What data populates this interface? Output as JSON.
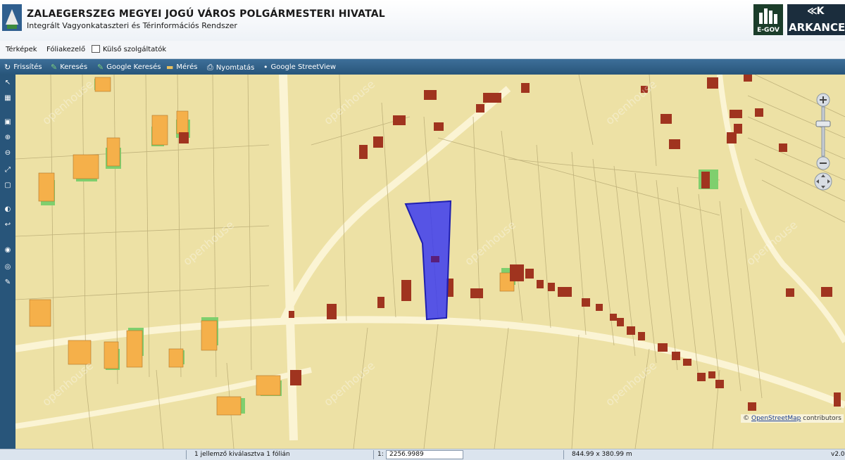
{
  "header": {
    "title": "ZALAEGERSZEG MEGYEI JOGÚ VÁROS POLGÁRMESTERI HIVATAL",
    "subtitle": "Integrált Vagyonkataszteri és Térinformációs Rendszer",
    "egov_logo": "E-GOV",
    "arkance_mark": "≪K",
    "arkance_logo": "ARKANCE"
  },
  "menu": [
    {
      "label": "Térképek"
    },
    {
      "label": "Fóliakezelő"
    },
    {
      "label": "Külső szolgáltatók"
    }
  ],
  "toolbar": [
    {
      "label": "Frissítés",
      "icon": "refresh-icon"
    },
    {
      "label": "Keresés",
      "icon": "search-icon"
    },
    {
      "label": "Google Keresés",
      "icon": "google-search-icon"
    },
    {
      "label": "Mérés",
      "icon": "ruler-icon"
    },
    {
      "label": "Nyomtatás",
      "icon": "print-icon"
    },
    {
      "label": "Google StreetView",
      "icon": "streetview-icon"
    }
  ],
  "map": {
    "background_color": "#ede1a5",
    "building_color": "#a0341f",
    "house_color": "#f5b04a",
    "selection_color": "#3b3bf0",
    "road_color": "#fbf4d4",
    "watermark": "openhouse",
    "copyright_prefix": "©",
    "copyright_link": "OpenStreetMap",
    "copyright_suffix": "contributors"
  },
  "status": {
    "selection": "1 jellemző kiválasztva 1 fólián",
    "scale_prefix": "1:",
    "scale_value": "2256.9989",
    "extent": "844.99 x 380.99 m",
    "version": "v2.0"
  }
}
